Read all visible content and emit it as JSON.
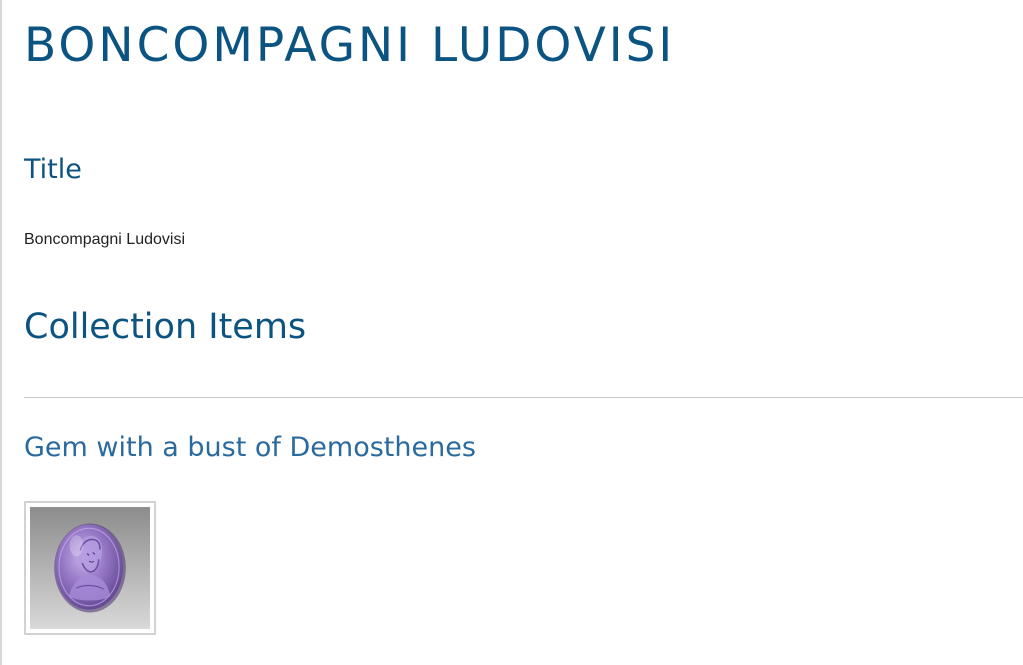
{
  "page": {
    "title": "BONCOMPAGNI LUDOVISI"
  },
  "fields": [
    {
      "label": "Title",
      "value": "Boncompagni Ludovisi"
    }
  ],
  "collection": {
    "heading": "Collection Items",
    "items": [
      {
        "title": "Gem with a bust of Demosthenes",
        "thumbnail": "amethyst-gem-bust-image"
      }
    ]
  },
  "colors": {
    "heading": "#0b5482",
    "link": "#2b6a9e",
    "body_text": "#222222",
    "divider": "#c8c8c8",
    "gem": "#8a6bb8"
  }
}
